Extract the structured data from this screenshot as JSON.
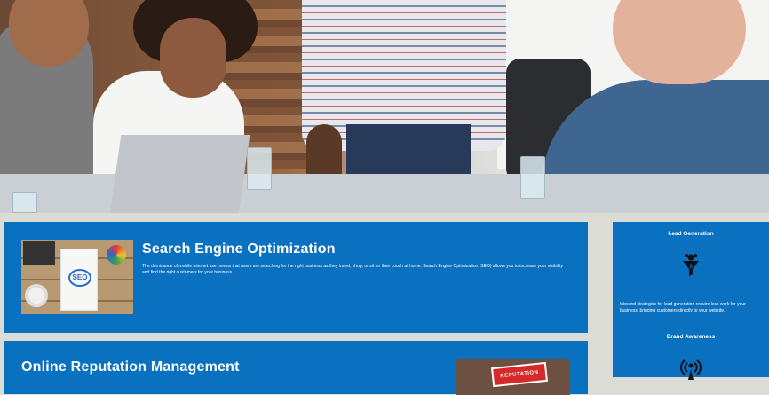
{
  "hero": {
    "image_alt": "team meeting photo"
  },
  "services": [
    {
      "title": "Search Engine Optimization",
      "description": "The dominance of mobile internet use means that users are searching for the right business as they travel, shop, or sit on their couch at home. Search Engine Optimization (SEO) allows you to increase your visibility and find the right customers for your business.",
      "thumb_label": "SEO"
    },
    {
      "title": "Online Reputation Management",
      "thumb_label": "REPUTATION"
    }
  ],
  "sidebar": {
    "items": [
      {
        "title": "Lead Generation",
        "icon": "funnel-dollar-icon",
        "text": "Inbound strategies for lead generation require less work for your business, bringing customers directly to your website."
      },
      {
        "title": "Brand Awareness",
        "icon": "broadcast-person-icon"
      }
    ]
  },
  "colors": {
    "card_blue": "#0a70c0",
    "page_bg": "#dcdcd6"
  }
}
